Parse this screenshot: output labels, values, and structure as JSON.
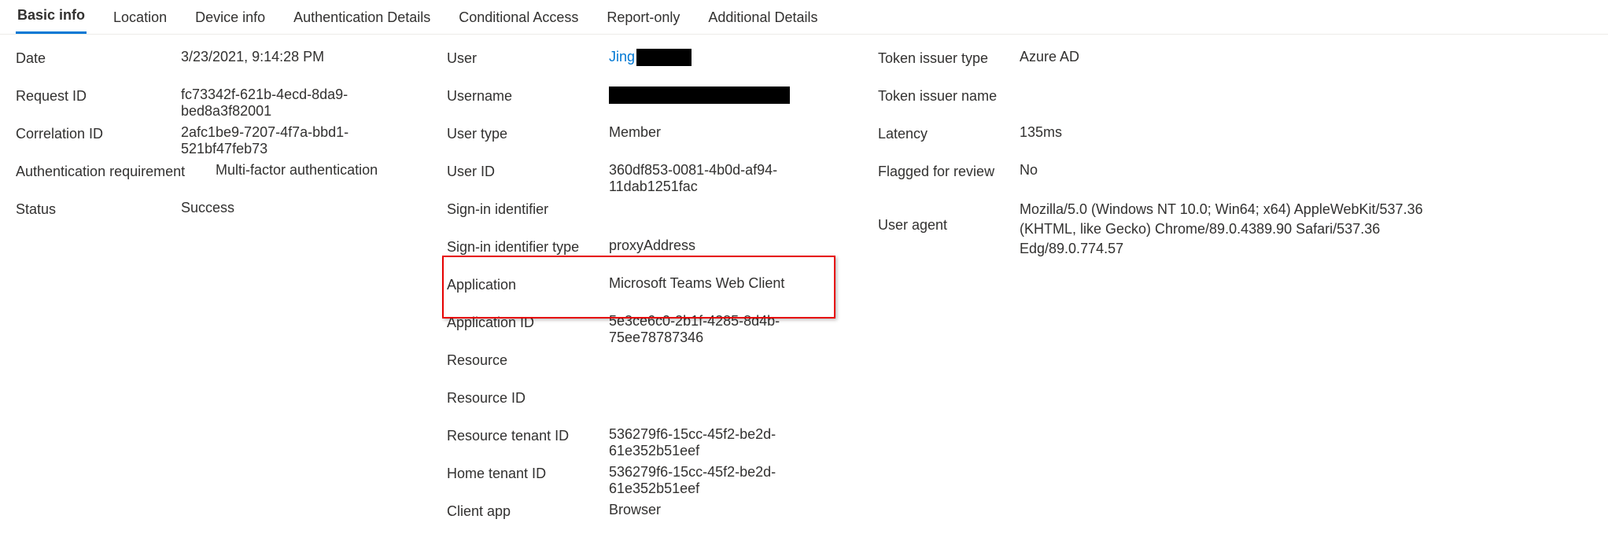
{
  "tabs": {
    "basic_info": "Basic info",
    "location": "Location",
    "device_info": "Device info",
    "auth_details": "Authentication Details",
    "conditional_access": "Conditional Access",
    "report_only": "Report-only",
    "additional_details": "Additional Details"
  },
  "col1": {
    "date_label": "Date",
    "date_value": "3/23/2021, 9:14:28 PM",
    "request_id_label": "Request ID",
    "request_id_value": "fc73342f-621b-4ecd-8da9-bed8a3f82001",
    "correlation_id_label": "Correlation ID",
    "correlation_id_value": "2afc1be9-7207-4f7a-bbd1-521bf47feb73",
    "auth_req_label": "Authentication requirement",
    "auth_req_value": "Multi-factor authentication",
    "status_label": "Status",
    "status_value": "Success"
  },
  "col2": {
    "user_label": "User",
    "user_value": "Jing",
    "username_label": "Username",
    "username_value": "",
    "user_type_label": "User type",
    "user_type_value": "Member",
    "user_id_label": "User ID",
    "user_id_value": "360df853-0081-4b0d-af94-11dab1251fac",
    "signin_identifier_label": "Sign-in identifier",
    "signin_identifier_value": "",
    "signin_identifier_type_label": "Sign-in identifier type",
    "signin_identifier_type_value": "proxyAddress",
    "application_label": "Application",
    "application_value": "Microsoft Teams Web Client",
    "application_id_label": "Application ID",
    "application_id_value": "5e3ce6c0-2b1f-4285-8d4b-75ee78787346",
    "resource_label": "Resource",
    "resource_value": "",
    "resource_id_label": "Resource ID",
    "resource_id_value": "",
    "resource_tenant_id_label": "Resource tenant ID",
    "resource_tenant_id_value": "536279f6-15cc-45f2-be2d-61e352b51eef",
    "home_tenant_id_label": "Home tenant ID",
    "home_tenant_id_value": "536279f6-15cc-45f2-be2d-61e352b51eef",
    "client_app_label": "Client app",
    "client_app_value": "Browser"
  },
  "col3": {
    "token_issuer_type_label": "Token issuer type",
    "token_issuer_type_value": "Azure AD",
    "token_issuer_name_label": "Token issuer name",
    "token_issuer_name_value": "",
    "latency_label": "Latency",
    "latency_value": "135ms",
    "flagged_label": "Flagged for review",
    "flagged_value": "No",
    "user_agent_label": "User agent",
    "user_agent_value": "Mozilla/5.0 (Windows NT 10.0; Win64; x64) AppleWebKit/537.36 (KHTML, like Gecko) Chrome/89.0.4389.90 Safari/537.36 Edg/89.0.774.57"
  }
}
